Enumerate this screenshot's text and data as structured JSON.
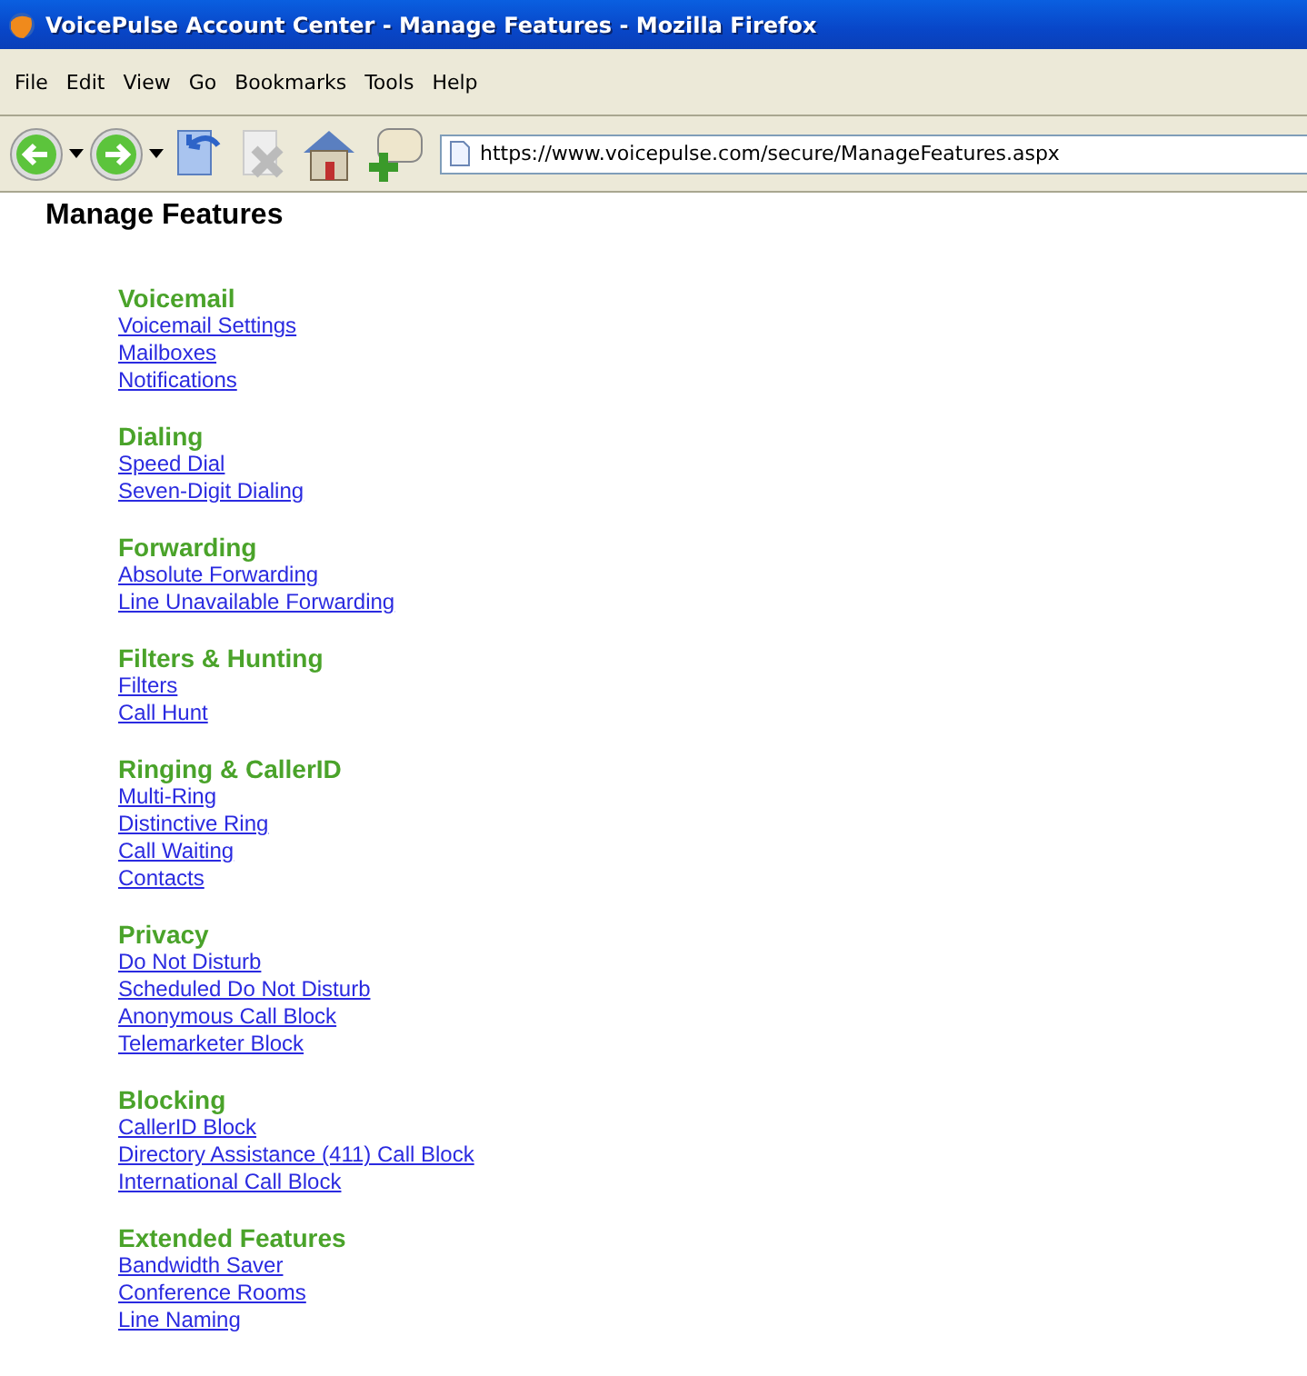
{
  "window": {
    "title": "VoicePulse Account Center - Manage Features - Mozilla Firefox"
  },
  "menu": [
    "File",
    "Edit",
    "View",
    "Go",
    "Bookmarks",
    "Tools",
    "Help"
  ],
  "address": {
    "value": "https://www.voicepulse.com/secure/ManageFeatures.aspx"
  },
  "page_title": "Manage Features",
  "sections": [
    {
      "heading": "Voicemail",
      "links": [
        "Voicemail Settings",
        "Mailboxes",
        "Notifications"
      ]
    },
    {
      "heading": "Dialing",
      "links": [
        "Speed Dial",
        "Seven-Digit Dialing"
      ]
    },
    {
      "heading": "Forwarding",
      "links": [
        "Absolute Forwarding",
        "Line Unavailable Forwarding"
      ]
    },
    {
      "heading": "Filters & Hunting",
      "links": [
        "Filters",
        "Call Hunt"
      ]
    },
    {
      "heading": "Ringing & CallerID",
      "links": [
        "Multi-Ring",
        "Distinctive Ring",
        "Call Waiting",
        "Contacts"
      ]
    },
    {
      "heading": "Privacy",
      "links": [
        "Do Not Disturb",
        "Scheduled Do Not Disturb",
        "Anonymous Call Block",
        "Telemarketer Block"
      ]
    },
    {
      "heading": "Blocking",
      "links": [
        "CallerID Block",
        "Directory Assistance (411) Call Block",
        "International Call Block"
      ]
    },
    {
      "heading": "Extended Features",
      "links": [
        "Bandwidth Saver",
        "Conference Rooms",
        "Line Naming"
      ]
    }
  ]
}
